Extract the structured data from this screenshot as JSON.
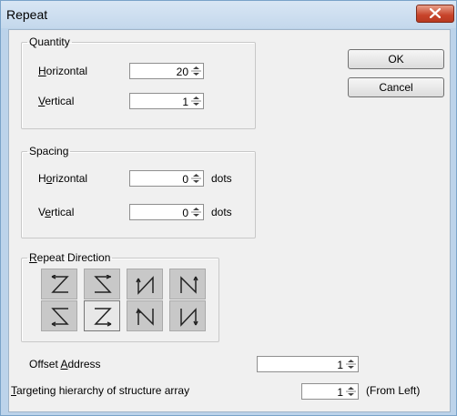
{
  "window": {
    "title": "Repeat"
  },
  "quantity": {
    "legend": "Quantity",
    "horizontal": {
      "label_hot": "H",
      "label_rest": "orizontal",
      "value": "20"
    },
    "vertical": {
      "label_hot": "V",
      "label_rest": "ertical",
      "value": "1"
    }
  },
  "spacing": {
    "legend": "Spacing",
    "horizontal": {
      "label_pre": "H",
      "label_hot": "o",
      "label_rest": "rizontal",
      "value": "0",
      "unit": "dots"
    },
    "vertical": {
      "label_pre": "V",
      "label_hot": "e",
      "label_rest": "rtical",
      "value": "0",
      "unit": "dots"
    }
  },
  "direction": {
    "legend_hot": "R",
    "legend_rest": "epeat Direction",
    "selected_index": 5,
    "buttons": [
      "row-z",
      "row-s",
      "col-n-up",
      "col-n-down",
      "row-z-rev",
      "row-z-down",
      "col-n-up-rev",
      "col-n-down-rev"
    ]
  },
  "offset": {
    "label_pre": "Offset ",
    "label_hot": "A",
    "label_rest": "ddress",
    "value": "1"
  },
  "targeting": {
    "label_hot": "T",
    "label_rest": "argeting hierarchy of structure array",
    "value": "1",
    "suffix": "(From Left)"
  },
  "buttons": {
    "ok": "OK",
    "cancel": "Cancel"
  }
}
